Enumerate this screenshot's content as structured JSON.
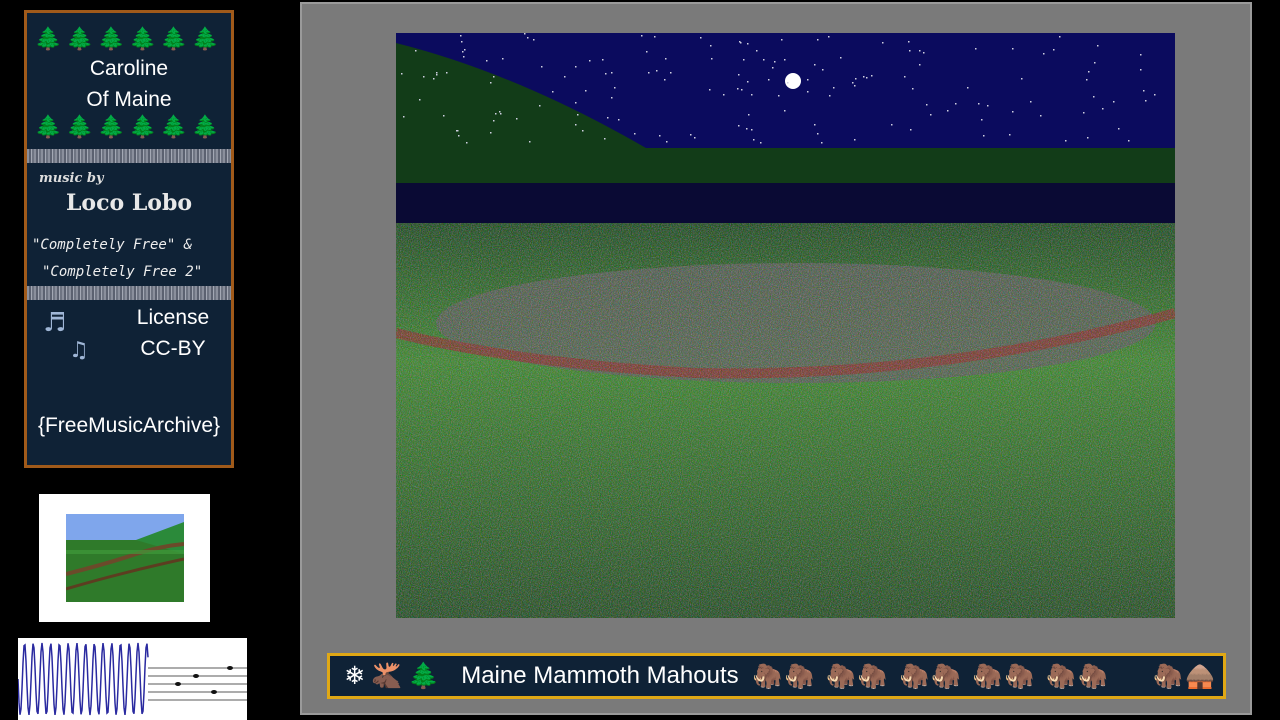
{
  "card": {
    "trees": "🌲🌲🌲🌲🌲🌲",
    "title_line1": "Caroline",
    "title_line2": "Of Maine",
    "music_by": "music by",
    "artist": "Loco Lobo",
    "album1": "\"Completely Free\" &",
    "album2": "\"Completely Free 2\"",
    "note_icon_1": "music-note-icon",
    "note_icon_2": "music-notes-icon",
    "license_line1": "License",
    "license_line2": "CC-BY",
    "source": "{FreeMusicArchive}"
  },
  "banner": {
    "icons": "❄🫎🌲",
    "title": "Maine Mammoth Mahouts",
    "mammoths": "🦣🦣 🦣🦣 🦣🦣 🦣🦣 🦣🦣",
    "end": "🦣🛖"
  },
  "colors": {
    "card_bg": "#0f2236",
    "card_border": "#a05a1a",
    "banner_border": "#e0a815",
    "frame_bg": "#7a7a7a",
    "night_sky": "#0b0b5e"
  }
}
